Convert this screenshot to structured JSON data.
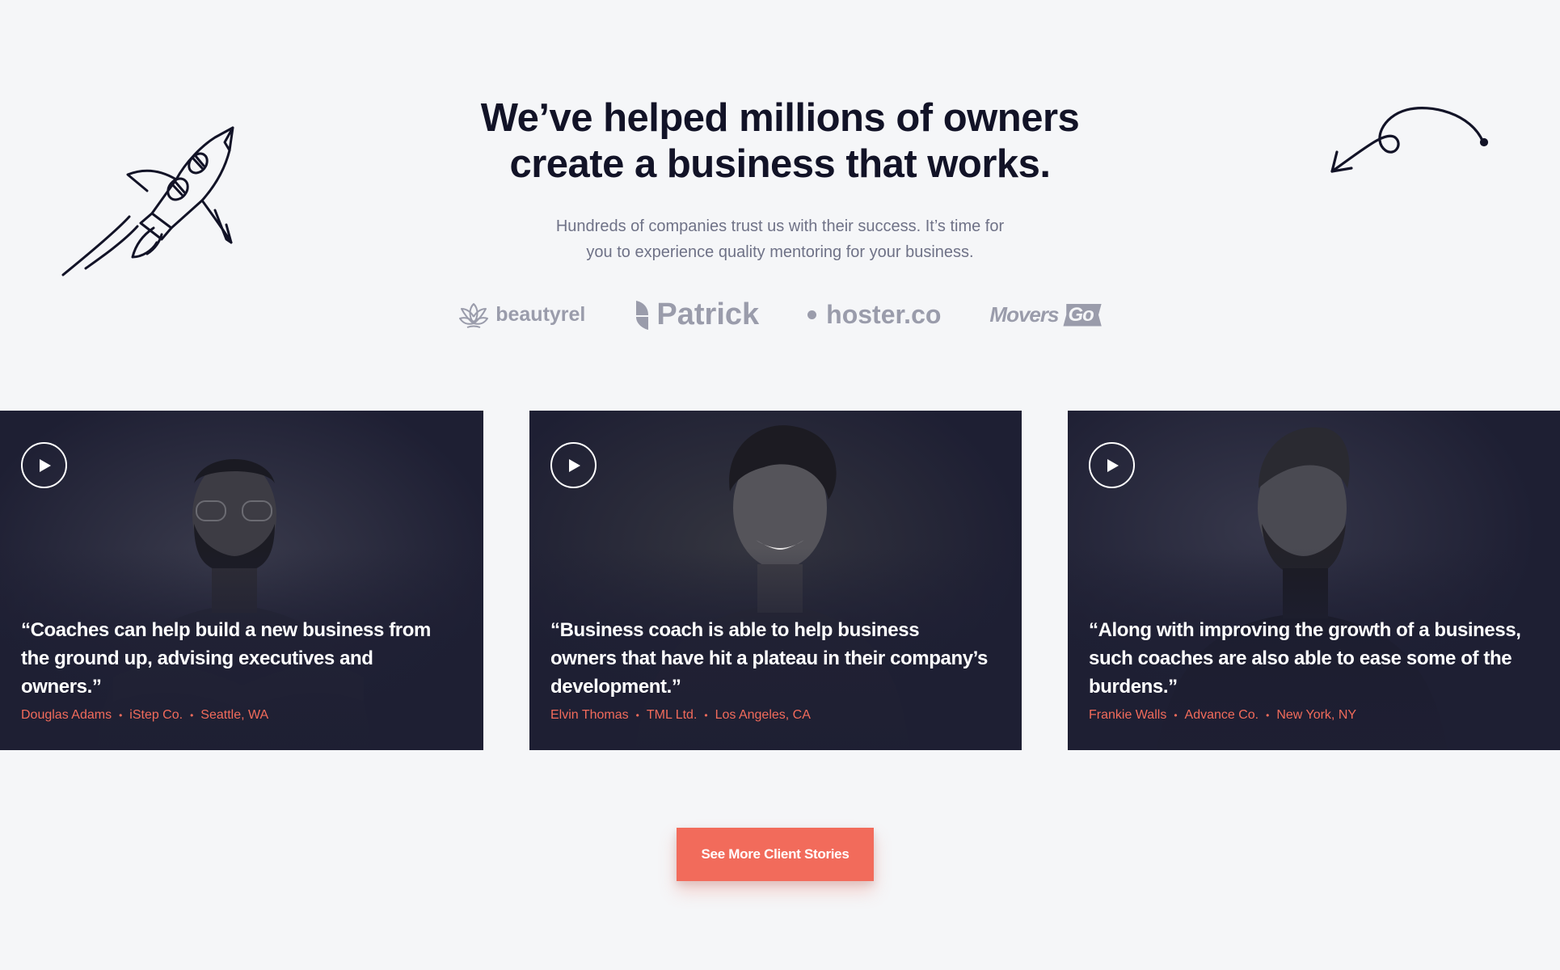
{
  "hero": {
    "headline_line1": "We’ve helped millions of owners",
    "headline_line2": "create a business that works.",
    "subhead_line1": "Hundreds of companies trust us with their success. It’s time for",
    "subhead_line2": "you to experience quality mentoring for your business."
  },
  "logos": {
    "beautyrel": "beautyrel",
    "patrick": "Patrick",
    "hoster": "hoster.co",
    "movers": "Movers",
    "movers_badge": "Go"
  },
  "testimonials": [
    {
      "quote": "“Coaches can help build a new business from the ground up, advising executives and owners.”",
      "name": "Douglas Adams",
      "company": "iStep Co.",
      "location": "Seattle, WA"
    },
    {
      "quote": "“Business coach is able to help business owners that have hit a plateau in their company’s development.”",
      "name": "Elvin Thomas",
      "company": "TML Ltd.",
      "location": "Los Angeles, CA"
    },
    {
      "quote": "“Along with improving the growth of a business, such coaches are also able to ease some of the burdens.”",
      "name": "Frankie Walls",
      "company": "Advance Co.",
      "location": "New York, NY"
    }
  ],
  "separator": "•",
  "cta": {
    "label": "See More Client Stories"
  },
  "colors": {
    "background": "#f5f6f8",
    "heading": "#121327",
    "card_bg": "#1e1f33",
    "accent": "#f26b5b",
    "logo_gray": "#9a9cab"
  },
  "icons": [
    "rocket-doodle-icon",
    "curved-arrow-doodle-icon",
    "lotus-icon",
    "leaf-icon",
    "play-icon"
  ]
}
